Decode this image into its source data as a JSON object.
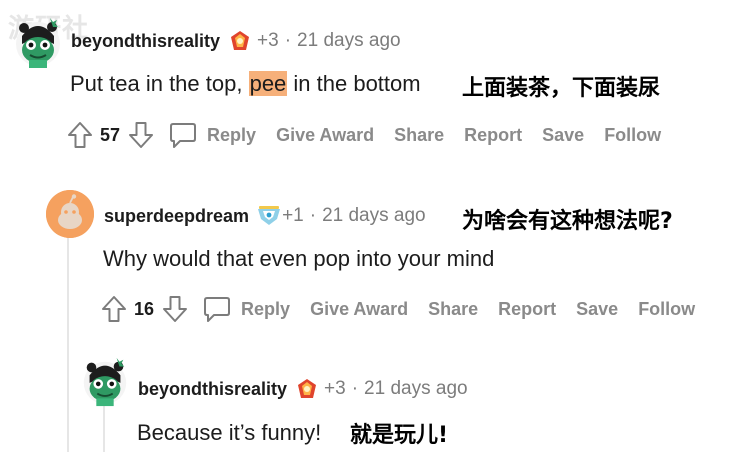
{
  "watermark": "游研社",
  "comments": [
    {
      "username": "beyondthisreality",
      "points": "+3",
      "time": "21 days ago",
      "text_before": "Put tea in the top, ",
      "text_highlight": "pee",
      "text_after": " in the bottom",
      "chinese": "上面装茶，下面装尿",
      "score": "57"
    },
    {
      "username": "superdeepdream",
      "points": "+1",
      "time": "21 days ago",
      "text": "Why would that even pop into your mind",
      "chinese": "为啥会有这种想法呢?",
      "score": "16"
    },
    {
      "username": "beyondthisreality",
      "points": "+3",
      "time": "21 days ago",
      "text": "Because it’s funny!",
      "chinese": "就是玩儿!"
    }
  ],
  "actions": {
    "reply": "Reply",
    "give_award": "Give Award",
    "share": "Share",
    "report": "Report",
    "save": "Save",
    "follow": "Follow"
  },
  "colors": {
    "highlight": "#f6b07a",
    "action_gray": "#8a8a8a",
    "meta_gray": "#7c7c7c",
    "avatar_orange": "#f5a15f",
    "avatar_green": "#2f9a63"
  },
  "icons": [
    "frog-avatar-icon",
    "snoo-avatar-icon",
    "award-icon",
    "upvote-icon",
    "downvote-icon",
    "comment-bubble-icon"
  ]
}
